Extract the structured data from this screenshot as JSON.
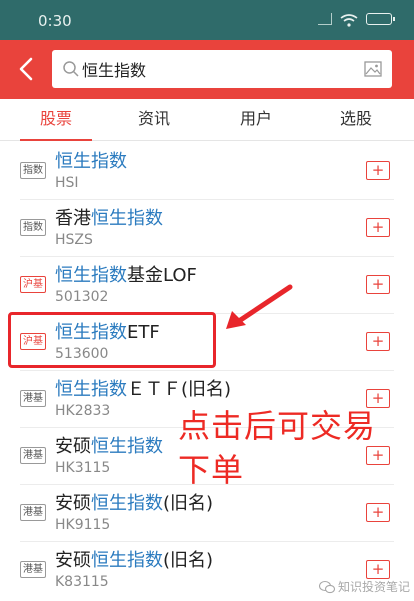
{
  "status_bar": {
    "time": "0:30"
  },
  "search": {
    "query": "恒生指数"
  },
  "tabs": [
    {
      "label": "股票",
      "active": true
    },
    {
      "label": "资讯",
      "active": false
    },
    {
      "label": "用户",
      "active": false
    },
    {
      "label": "选股",
      "active": false
    }
  ],
  "results": [
    {
      "badge": "指数",
      "badge_color": "#555555",
      "prefix": "",
      "highlight": "恒生指数",
      "suffix": "",
      "code": "HSI",
      "add": "+"
    },
    {
      "badge": "指数",
      "badge_color": "#555555",
      "prefix": "香港",
      "highlight": "恒生指数",
      "suffix": "",
      "code": "HSZS",
      "add": "+"
    },
    {
      "badge": "沪基",
      "badge_color": "#e9433c",
      "prefix": "",
      "highlight": "恒生指数",
      "suffix": "基金LOF",
      "code": "501302",
      "add": "+"
    },
    {
      "badge": "沪基",
      "badge_color": "#e9433c",
      "prefix": "",
      "highlight": "恒生指数",
      "suffix": "ETF",
      "code": "513600",
      "add": "+"
    },
    {
      "badge": "港基",
      "badge_color": "#555555",
      "prefix": "",
      "highlight": "恒生指数",
      "suffix": "ＥＴＦ(旧名)",
      "code": "HK2833",
      "add": "+"
    },
    {
      "badge": "港基",
      "badge_color": "#555555",
      "prefix": "安硕",
      "highlight": "恒生指数",
      "suffix": "",
      "code": "HK3115",
      "add": "+"
    },
    {
      "badge": "港基",
      "badge_color": "#555555",
      "prefix": "安硕",
      "highlight": "恒生指数",
      "suffix": "(旧名)",
      "code": "HK9115",
      "add": "+"
    },
    {
      "badge": "港基",
      "badge_color": "#555555",
      "prefix": "安硕",
      "highlight": "恒生指数",
      "suffix": "(旧名)",
      "code": "K83115",
      "add": "+"
    }
  ],
  "annotation": {
    "line1": "点击后可交易",
    "line2": "下单"
  },
  "watermark": {
    "text": "知识投资笔记"
  },
  "colors": {
    "brand_red": "#e9433c",
    "highlight_blue": "#2b7bbf",
    "status_bar": "#2f6b6a"
  }
}
